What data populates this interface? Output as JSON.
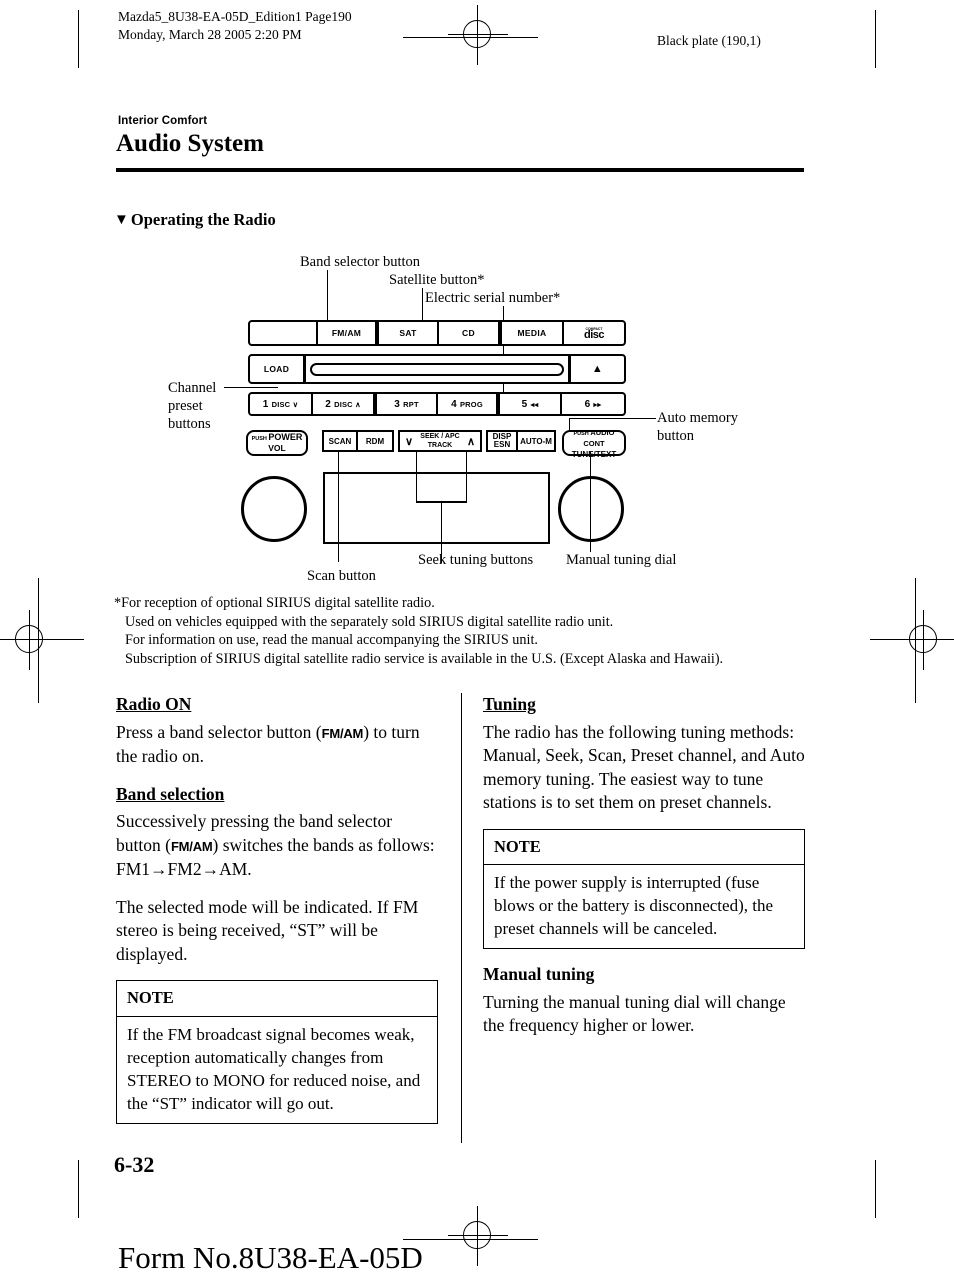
{
  "page_header": {
    "line1": "Mazda5_8U38-EA-05D_Edition1 Page190",
    "line2": "Monday, March 28 2005 2:20 PM",
    "black_plate": "Black plate (190,1)"
  },
  "section": {
    "kicker": "Interior Comfort",
    "chapter_title": "Audio System",
    "heading_marker": "▼",
    "heading": "Operating the Radio"
  },
  "diagram": {
    "callouts": {
      "band_selector": "Band selector button",
      "satellite": "Satellite button*",
      "serial": "Electric serial number*",
      "channel_preset_l1": "Channel",
      "channel_preset_l2": "preset",
      "channel_preset_l3": "buttons",
      "auto_memory_l1": "Auto memory",
      "auto_memory_l2": "button",
      "scan": "Scan button",
      "seek": "Seek tuning buttons",
      "manual_dial": "Manual tuning dial"
    },
    "row1": [
      {
        "label": "",
        "name": "blank-display-button"
      },
      {
        "label": "FM/AM",
        "name": "fm-am-button"
      },
      {
        "label": "SAT",
        "name": "sat-button"
      },
      {
        "label": "CD",
        "name": "cd-button"
      },
      {
        "label": "MEDIA",
        "name": "media-button"
      },
      {
        "label": "disc",
        "sublabel": "COMPACT",
        "name": "compact-disc-logo"
      }
    ],
    "row2": {
      "load": "LOAD",
      "eject": "▲"
    },
    "row3": [
      {
        "num": "1",
        "sub": "DISC ∨"
      },
      {
        "num": "2",
        "sub": "DISC ∧"
      },
      {
        "num": "3",
        "sub": "RPT"
      },
      {
        "num": "4",
        "sub": "PROG"
      },
      {
        "num": "5",
        "sub": "◂◂"
      },
      {
        "num": "6",
        "sub": "▸▸"
      }
    ],
    "controls": {
      "power_push": "PUSH",
      "power_l1": "POWER",
      "power_l2": "VOL",
      "scan": "SCAN",
      "rdm": "RDM",
      "seek_l1": "SEEK / APC",
      "seek_l2": "TRACK",
      "seek_down": "∨",
      "seek_up": "∧",
      "disp_l1": "DISP",
      "disp_l2": "ESN",
      "auto_m": "AUTO-M",
      "audio_push": "PUSH",
      "audio_l1": "AUDIO CONT",
      "audio_l2": "TUNE/TEXT"
    }
  },
  "footnote": {
    "l1": "*For reception of optional SIRIUS digital satellite radio.",
    "l2": "Used on vehicles equipped with the separately sold SIRIUS digital satellite radio unit.",
    "l3": "For information on use, read the manual accompanying the SIRIUS unit.",
    "l4": "Subscription of SIRIUS digital satellite radio service is available in the U.S. (Except Alaska and Hawaii)."
  },
  "left_column": {
    "radio_on_heading": "Radio ON",
    "radio_on_p_a": "Press a band selector button (",
    "radio_on_btn": "FM/AM",
    "radio_on_p_b": ") to turn the radio on.",
    "band_selection_heading": "Band selection",
    "band_p_a": "Successively pressing the band selector button (",
    "band_btn": "FM/AM",
    "band_p_b": ") switches the bands as follows: FM1→FM2→AM.",
    "mode_para": "The selected mode will be indicated. If FM stereo is being received, “ST” will be displayed.",
    "note_title": "NOTE",
    "note_body": "If the FM broadcast signal becomes weak, reception automatically changes from STEREO to MONO for reduced noise, and the “ST” indicator will go out."
  },
  "right_column": {
    "tuning_heading": "Tuning",
    "tuning_para": "The radio has the following tuning methods: Manual, Seek, Scan, Preset channel, and Auto memory tuning. The easiest way to tune stations is to set them on preset channels.",
    "note_title": "NOTE",
    "note_body": "If the power supply is interrupted (fuse blows or the battery is disconnected), the preset channels will be canceled.",
    "manual_heading": "Manual tuning",
    "manual_para": "Turning the manual tuning dial will change the frequency higher or lower."
  },
  "footer": {
    "page_number": "6-32",
    "form_number": "Form No.8U38-EA-05D"
  }
}
